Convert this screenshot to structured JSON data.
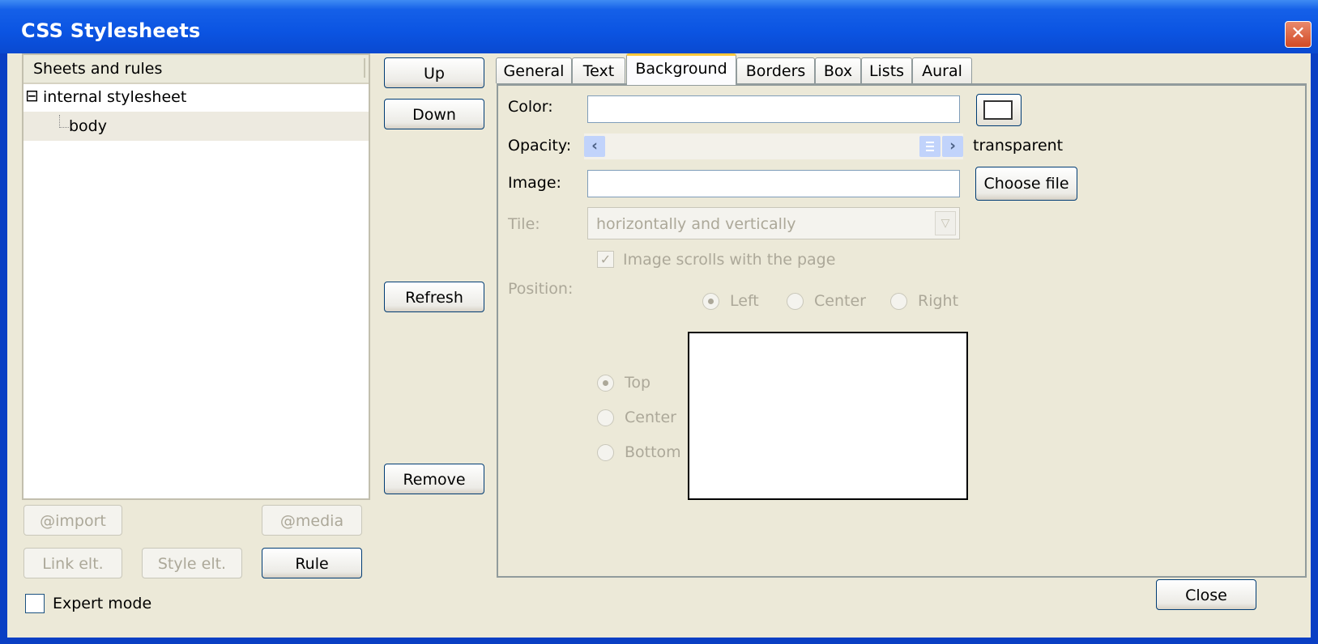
{
  "window": {
    "title": "CSS Stylesheets",
    "close_glyph": "✕"
  },
  "tree": {
    "header": "Sheets and rules",
    "items": [
      {
        "label": "internal stylesheet",
        "expander": "⊟"
      },
      {
        "label": "body"
      }
    ]
  },
  "left_buttons": {
    "import": "@import",
    "media": "@media",
    "link": "Link elt.",
    "style": "Style elt.",
    "rule": "Rule"
  },
  "expert_mode": {
    "label": "Expert mode",
    "checked": false
  },
  "middle_buttons": {
    "up": "Up",
    "down": "Down",
    "refresh": "Refresh",
    "remove": "Remove"
  },
  "tabs": [
    "General",
    "Text",
    "Background",
    "Borders",
    "Box",
    "Lists",
    "Aural"
  ],
  "active_tab": "Background",
  "background": {
    "color_label": "Color:",
    "color_value": "",
    "opacity_label": "Opacity:",
    "opacity_value": "transparent",
    "image_label": "Image:",
    "image_value": "",
    "choose_file": "Choose file",
    "tile_label": "Tile:",
    "tile_value": "horizontally and vertically",
    "scroll_label": "Image scrolls with the page",
    "scroll_checked": true,
    "position_label": "Position:",
    "horizontal": [
      "Left",
      "Center",
      "Right"
    ],
    "horizontal_selected": "Left",
    "vertical": [
      "Top",
      "Center",
      "Bottom"
    ],
    "vertical_selected": "Top"
  },
  "footer": {
    "close": "Close"
  },
  "colors": {
    "title_bar": "#0B54E2",
    "face": "#ECE9D8",
    "focus_border": "#003C74",
    "active_tab_highlight": "#FFC83C"
  }
}
